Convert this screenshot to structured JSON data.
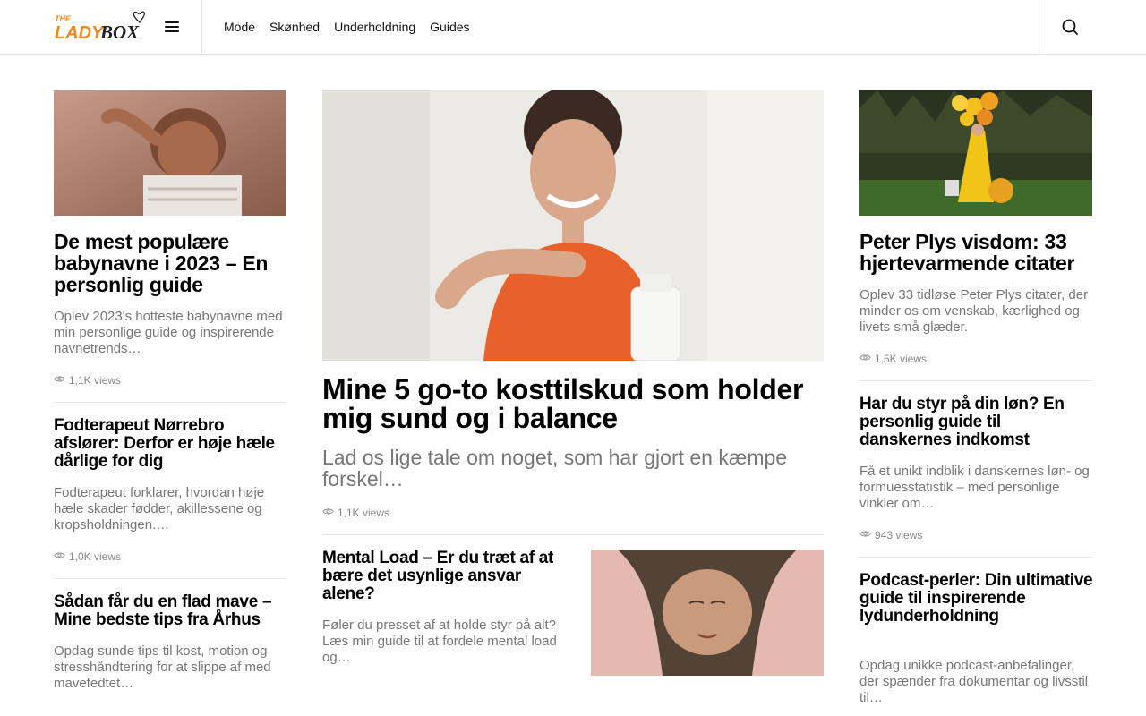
{
  "header": {
    "logo_text": "THE LADY BOX",
    "nav": [
      "Mode",
      "Skønhed",
      "Underholdning",
      "Guides"
    ]
  },
  "left": [
    {
      "title": "De mest populære babynavne i 2023 – En personlig guide",
      "excerpt": "Oplev 2023's hotteste babynavne med min personlige guide og inspirerende navnetrends…",
      "views": "1,1K views"
    },
    {
      "title": "Fodterapeut Nørrebro afslører: Derfor er høje hæle dårlige for dig",
      "excerpt": "Fodterapeut forklarer, hvordan høje hæle skader fødder, akillessene og kropsholdningen.…",
      "views": "1,0K views"
    },
    {
      "title": "Sådan får du en flad mave – Mine bedste tips fra Århus",
      "excerpt": "Opdag sunde tips til kost, motion og stresshåndtering for at slippe af med mavefedtet…"
    }
  ],
  "center": {
    "featured": {
      "title": "Mine 5 go-to kosttilskud som holder mig sund og i balance",
      "excerpt": "Lad os lige tale om noget, som har gjort en kæmpe forskel…",
      "views": "1,1K views"
    },
    "secondary": {
      "title": "Mental Load – Er du træt af at bære det usynlige ansvar alene?",
      "excerpt": "Føler du presset af at holde styr på alt? Læs min guide til at fordele mental load og…"
    }
  },
  "right": [
    {
      "title": "Peter Plys visdom: 33 hjertevarmende citater",
      "excerpt": "Oplev 33 tidløse Peter Plys citater, der minder os om venskab, kærlighed og livets små glæder.",
      "views": "1,5K views"
    },
    {
      "title": "Har du styr på din løn? En personlig guide til danskernes indkomst",
      "excerpt": "Få et unikt indblik i danskernes løn- og formuesstatistik – med personlige vinkler om…",
      "views": "943 views"
    },
    {
      "title": "Podcast-perler: Din ultimative guide til inspirerende lydunderholdning",
      "excerpt": "Opdag unikke podcast-anbefalinger, der spænder fra dokumentar og livsstil til…"
    }
  ],
  "colors": {
    "logo_orange": "#f08a1c",
    "text": "#000000",
    "muted": "#777777",
    "divider": "#e6e6e6"
  }
}
